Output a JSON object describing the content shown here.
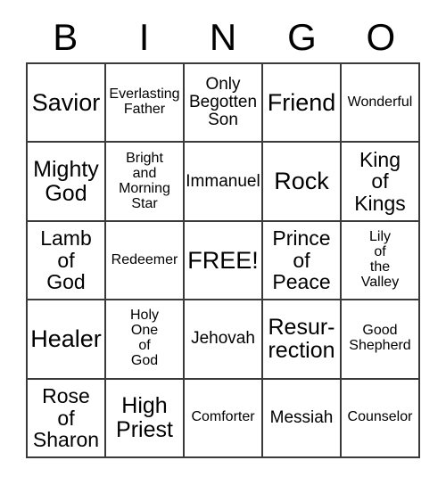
{
  "card": {
    "header_letters": [
      "B",
      "I",
      "N",
      "G",
      "O"
    ],
    "colors": {
      "background": "#ffffff",
      "border": "#3a3a3a",
      "text": "#000000"
    },
    "rows": [
      [
        {
          "label": "Savior",
          "size": "xxl"
        },
        {
          "label": "Everlasting\nFather",
          "size": "s"
        },
        {
          "label": "Only\nBegotten\nSon",
          "size": "m"
        },
        {
          "label": "Friend",
          "size": "xxl"
        },
        {
          "label": "Wonderful",
          "size": "s"
        }
      ],
      [
        {
          "label": "Mighty\nGod",
          "size": "xl"
        },
        {
          "label": "Bright\nand\nMorning\nStar",
          "size": "s"
        },
        {
          "label": "Immanuel",
          "size": "m"
        },
        {
          "label": "Rock",
          "size": "xxl"
        },
        {
          "label": "King\nof\nKings",
          "size": "l"
        }
      ],
      [
        {
          "label": "Lamb\nof\nGod",
          "size": "l"
        },
        {
          "label": "Redeemer",
          "size": "s"
        },
        {
          "label": "FREE!",
          "size": "xxl"
        },
        {
          "label": "Prince\nof\nPeace",
          "size": "l"
        },
        {
          "label": "Lily\nof\nthe\nValley",
          "size": "s"
        }
      ],
      [
        {
          "label": "Healer",
          "size": "xxl"
        },
        {
          "label": "Holy\nOne\nof\nGod",
          "size": "s"
        },
        {
          "label": "Jehovah",
          "size": "m"
        },
        {
          "label": "Resur-\nrection",
          "size": "xl"
        },
        {
          "label": "Good\nShepherd",
          "size": "s"
        }
      ],
      [
        {
          "label": "Rose\nof\nSharon",
          "size": "l"
        },
        {
          "label": "High\nPriest",
          "size": "xl"
        },
        {
          "label": "Comforter",
          "size": "s"
        },
        {
          "label": "Messiah",
          "size": "m"
        },
        {
          "label": "Counselor",
          "size": "s"
        }
      ]
    ]
  }
}
